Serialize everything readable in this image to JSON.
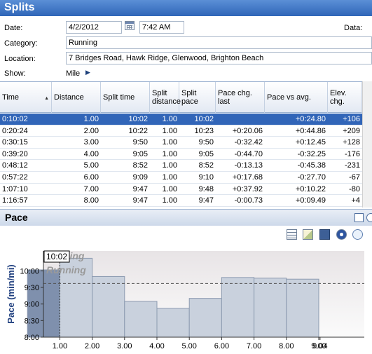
{
  "window": {
    "title": "Splits"
  },
  "form": {
    "date_label": "Date:",
    "date_value": "4/2/2012",
    "time_value": "7:42 AM",
    "data_label": "Data:",
    "category_label": "Category:",
    "category_value": "Running",
    "location_label": "Location:",
    "location_value": "7 Bridges Road, Hawk Ridge, Glenwood, Brighton Beach",
    "show_label": "Show:",
    "show_value": "Mile"
  },
  "table": {
    "columns": [
      "Time",
      "Distance",
      "Split time",
      "Split distance",
      "Split pace",
      "Pace chg. last",
      "Pace vs avg.",
      "Elev. chg."
    ],
    "rows": [
      [
        "0:10:02",
        "1.00",
        "10:02",
        "1.00",
        "10:02",
        "",
        "+0:24.80",
        "+106"
      ],
      [
        "0:20:24",
        "2.00",
        "10:22",
        "1.00",
        "10:23",
        "+0:20.06",
        "+0:44.86",
        "+209"
      ],
      [
        "0:30:15",
        "3.00",
        "9:50",
        "1.00",
        "9:50",
        "-0:32.42",
        "+0:12.45",
        "+128"
      ],
      [
        "0:39:20",
        "4.00",
        "9:05",
        "1.00",
        "9:05",
        "-0:44.70",
        "-0:32.25",
        "-176"
      ],
      [
        "0:48:12",
        "5.00",
        "8:52",
        "1.00",
        "8:52",
        "-0:13.13",
        "-0:45.38",
        "-231"
      ],
      [
        "0:57:22",
        "6.00",
        "9:09",
        "1.00",
        "9:10",
        "+0:17.68",
        "-0:27.70",
        "-67"
      ],
      [
        "1:07:10",
        "7.00",
        "9:47",
        "1.00",
        "9:48",
        "+0:37.92",
        "+0:10.22",
        "-80"
      ],
      [
        "1:16:57",
        "8.00",
        "9:47",
        "1.00",
        "9:47",
        "-0:00.73",
        "+0:09.49",
        "+4"
      ]
    ],
    "selected_row": 0
  },
  "pane": {
    "title": "Pace"
  },
  "toolbar_icons": [
    "lines-icon",
    "chart-image-icon",
    "save-icon",
    "options-gear-icon",
    "zoom-icon"
  ],
  "chart_data": {
    "type": "bar",
    "ylabel": "Pace (min/mi)",
    "x_ticks": [
      "1.00",
      "2.00",
      "3.00",
      "4.00",
      "5.00",
      "6.00",
      "7.00",
      "8.00",
      "9.00",
      "9.04"
    ],
    "y_ticks": [
      "8:00",
      "8:30",
      "9:00",
      "9:30",
      "10:00"
    ],
    "ylim": [
      8.0,
      10.6
    ],
    "bars": [
      {
        "start": 0.0,
        "end": 1.0,
        "pace": 10.03
      },
      {
        "start": 1.0,
        "end": 2.0,
        "pace": 10.38
      },
      {
        "start": 2.0,
        "end": 3.0,
        "pace": 9.83
      },
      {
        "start": 3.0,
        "end": 4.0,
        "pace": 9.08
      },
      {
        "start": 4.0,
        "end": 5.0,
        "pace": 8.87
      },
      {
        "start": 5.0,
        "end": 6.0,
        "pace": 9.17
      },
      {
        "start": 6.0,
        "end": 7.0,
        "pace": 9.8
      },
      {
        "start": 7.0,
        "end": 8.0,
        "pace": 9.78
      },
      {
        "start": 8.0,
        "end": 9.0,
        "pace": 9.75
      }
    ],
    "average_line": 9.62,
    "cursor_label": "10:02",
    "overlay_text": [
      "Jogging",
      "Running"
    ],
    "bar_color": "#c9d1dd",
    "highlight_color": "#7f90ad"
  }
}
